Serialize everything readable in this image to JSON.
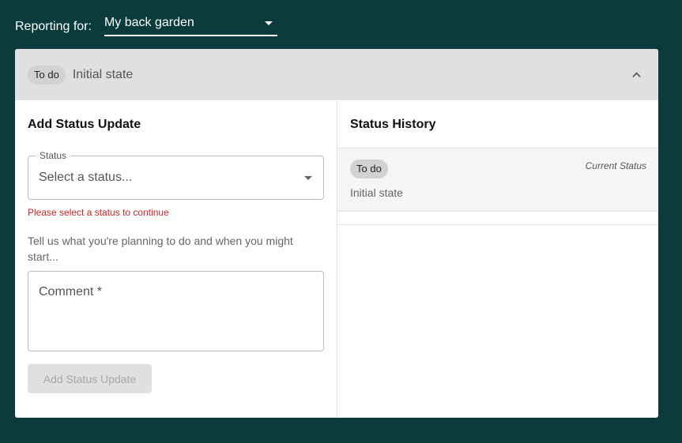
{
  "reporting": {
    "label": "Reporting for:",
    "selected_site": "My back garden"
  },
  "card_header": {
    "status_chip": "To do",
    "state": "Initial state"
  },
  "add_update": {
    "title": "Add Status Update",
    "status_legend": "Status",
    "status_placeholder": "Select a status...",
    "error": "Please select a status to continue",
    "helper": "Tell us what you're planning to do and when you might start...",
    "comment_placeholder": "Comment *",
    "submit_label": "Add Status Update"
  },
  "history": {
    "title": "Status History",
    "items": [
      {
        "status": "To do",
        "badge": "Current Status",
        "state": "Initial state"
      }
    ]
  },
  "icons": {
    "collapse": "chevron-up-icon",
    "site_dropdown": "caret-down-icon",
    "status_dropdown": "caret-down-icon"
  },
  "colors": {
    "background": "#0b3b3c",
    "header": "#e0e0e0",
    "error": "#c62828"
  }
}
